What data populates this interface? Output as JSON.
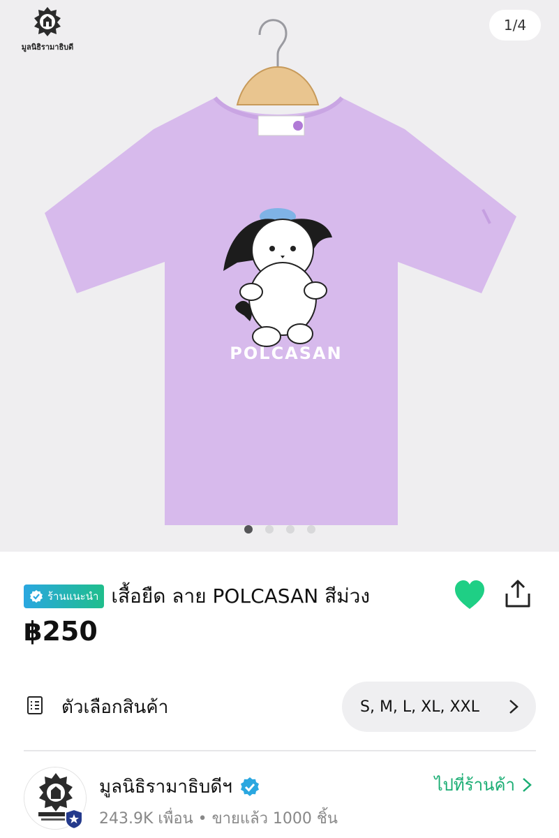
{
  "header": {
    "brand_name": "มูลนิธิรามาธิบดี",
    "image_counter": "1/4",
    "image_count": 4,
    "active_image": 1
  },
  "product": {
    "print_text": "POLCASAN",
    "shirt_color": "#d7baec",
    "badge_label": "ร้านแนะนำ",
    "title": "เสื้อยืด ลาย POLCASAN สีม่วง",
    "price": "฿250",
    "favorited": true
  },
  "options": {
    "label": "ตัวเลือกสินค้า",
    "value": "S, M, L, XL, XXL"
  },
  "shop": {
    "name": "มูลนิธิรามาธิบดีฯ",
    "meta": "243.9K เพื่อน • ขายแล้ว 1000 ชิ้น",
    "link_label": "ไปที่ร้านค้า"
  },
  "colors": {
    "accent_green": "#1fcf85",
    "link_green": "#1aad73",
    "badge_blue": "#2aa7e0"
  },
  "icons": [
    "foundation-emblem-icon",
    "share-icon",
    "heart-icon",
    "list-icon",
    "chevron-right-icon",
    "verified-icon",
    "star-shield-icon"
  ]
}
